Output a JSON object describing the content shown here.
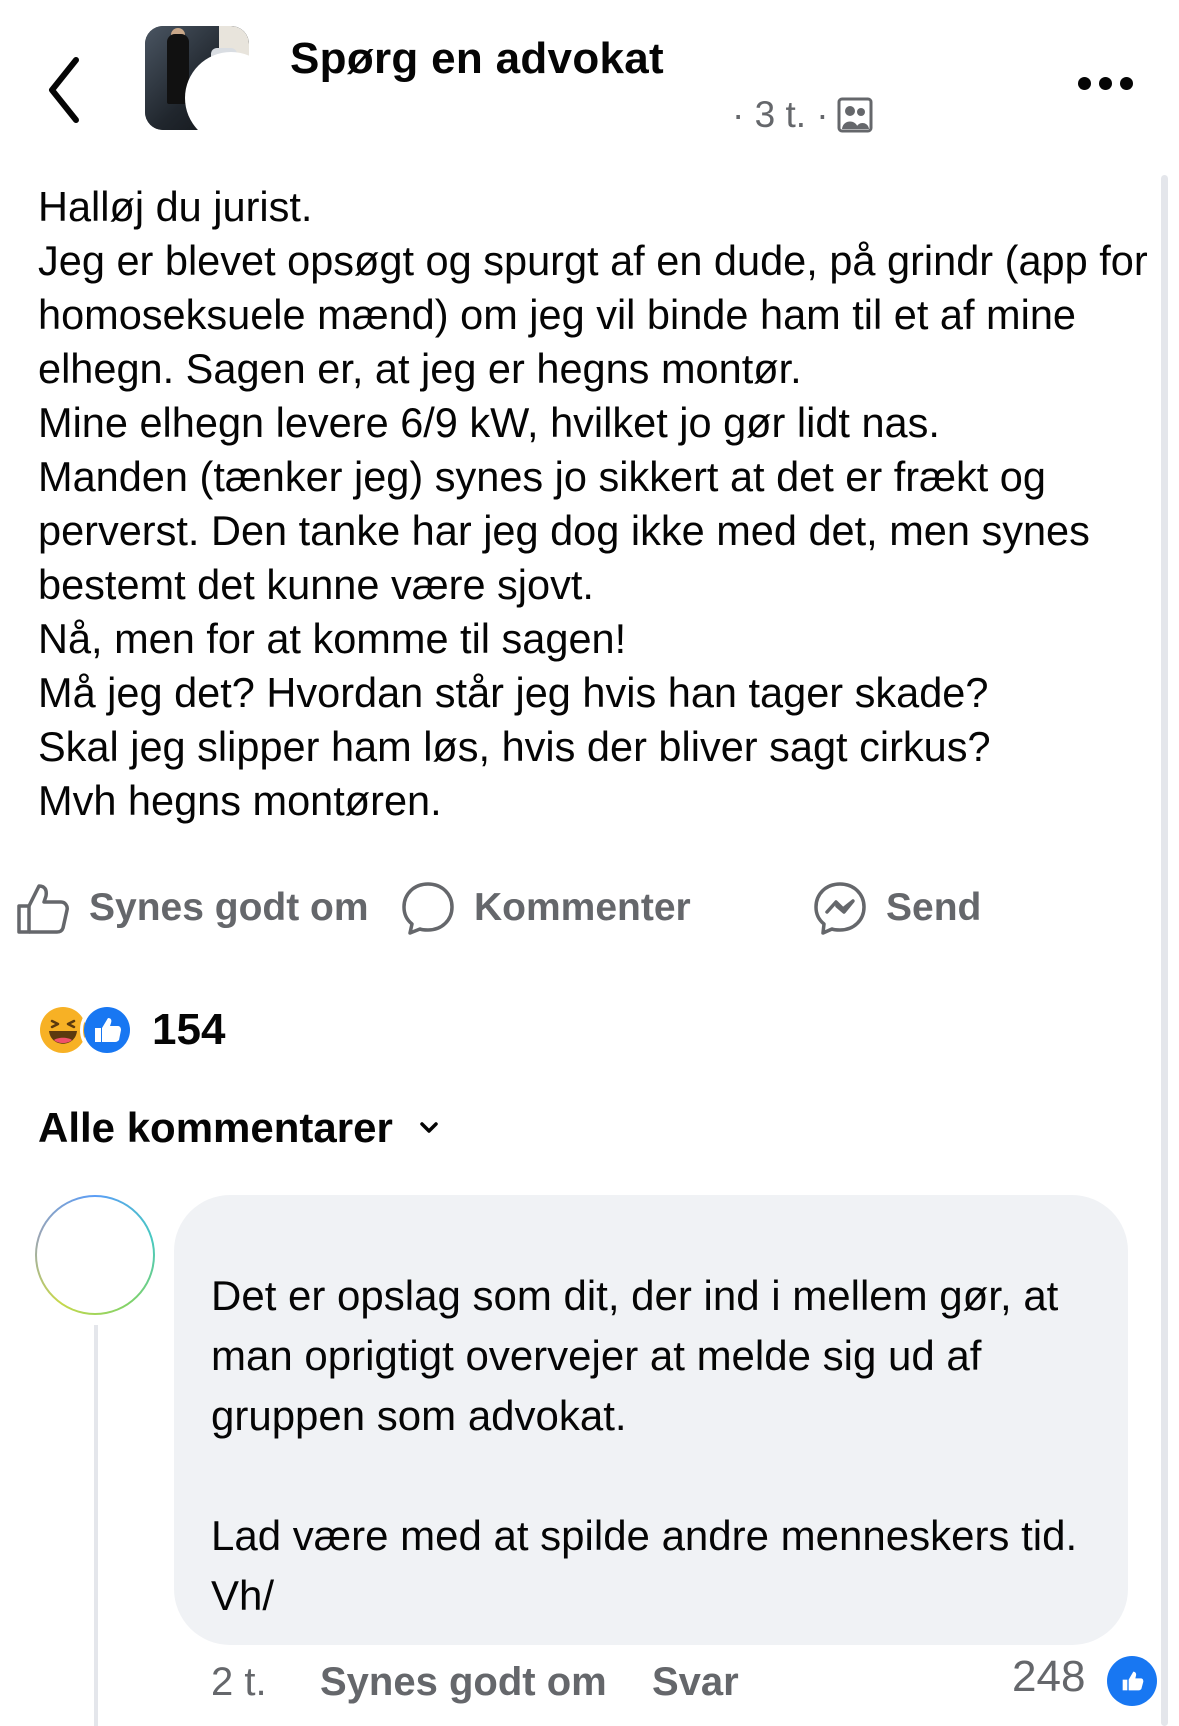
{
  "header": {
    "title": "Spørg en advokat",
    "time": "· 3 t. ·"
  },
  "post": {
    "text": "Halløj du jurist.\nJeg er blevet opsøgt og spurgt af en dude, på grindr (app for homoseksuele mænd) om jeg vil binde ham til et af mine elhegn. Sagen er, at jeg er hegns montør.\nMine elhegn levere 6/9 kW, hvilket jo gør lidt nas.\nManden (tænker jeg) synes jo sikkert at det er frækt og perverst. Den tanke har jeg dog ikke med det, men synes bestemt det kunne være sjovt.\nNå, men for at komme til sagen!\nMå jeg det? Hvordan står jeg hvis han tager skade?\nSkal jeg slipper ham løs, hvis der bliver sagt cirkus?\nMvh hegns montøren."
  },
  "actions": {
    "like_label": "Synes godt om",
    "comment_label": "Kommenter",
    "send_label": "Send"
  },
  "reactions": {
    "count": "154"
  },
  "comments_section": {
    "filter_label": "Alle kommentarer"
  },
  "comment": {
    "text": "Det er opslag som dit, der ind i mellem gør, at man oprigtigt overvejer at melde sig ud af gruppen som advokat.\n\nLad være med at spilde andre menneskers tid. Vh/",
    "time": "2 t.",
    "like_label": "Synes godt om",
    "reply_label": "Svar",
    "like_count": "248"
  },
  "colors": {
    "text": "#050505",
    "secondary": "#65676b",
    "bubble": "#f0f2f5",
    "like_blue": "#1877f2",
    "haha_yellow": "#f7b125"
  }
}
